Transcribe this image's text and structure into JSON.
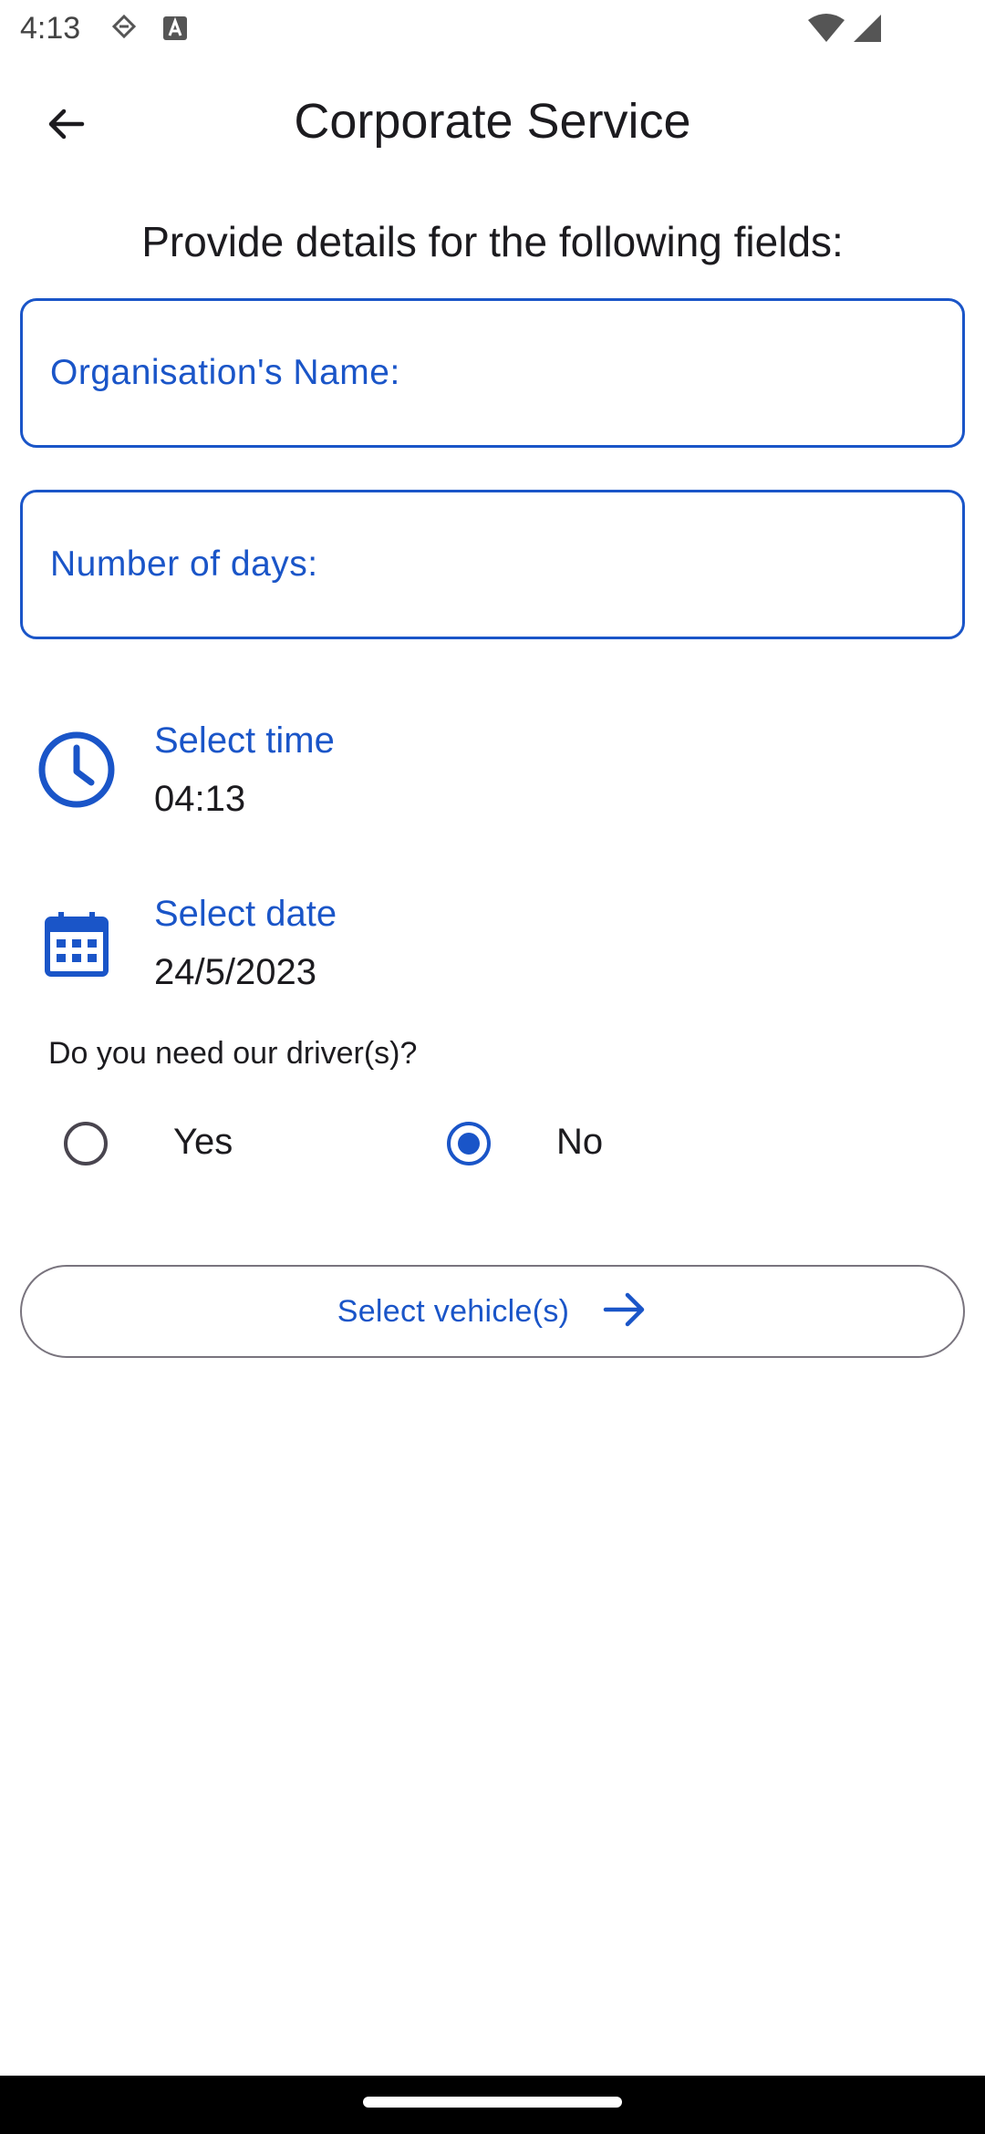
{
  "status_bar": {
    "time": "4:13",
    "icons": [
      "dnd-shield-icon",
      "text-a-icon",
      "wifi-icon",
      "cell-signal-icon"
    ]
  },
  "app_bar": {
    "back_icon": "arrow-back-icon",
    "title": "Corporate Service"
  },
  "form": {
    "intro": "Provide details for the following fields:",
    "org_name": {
      "placeholder": "Organisation's Name:",
      "value": ""
    },
    "days": {
      "placeholder": "Number of days:",
      "value": ""
    },
    "time_picker": {
      "label": "Select time",
      "value": "04:13",
      "icon": "clock-icon"
    },
    "date_picker": {
      "label": "Select date",
      "value": "24/5/2023",
      "icon": "calendar-icon"
    },
    "driver_question": "Do you need our driver(s)?",
    "driver_options": [
      {
        "label": "Yes",
        "selected": false
      },
      {
        "label": "No",
        "selected": true
      }
    ],
    "next_button": {
      "label": "Select vehicle(s)",
      "icon": "arrow-forward-icon"
    }
  },
  "colors": {
    "accent": "#1a55c8",
    "text": "#1c1b1f",
    "outline": "#79747e",
    "nav_bar": "#000000"
  }
}
